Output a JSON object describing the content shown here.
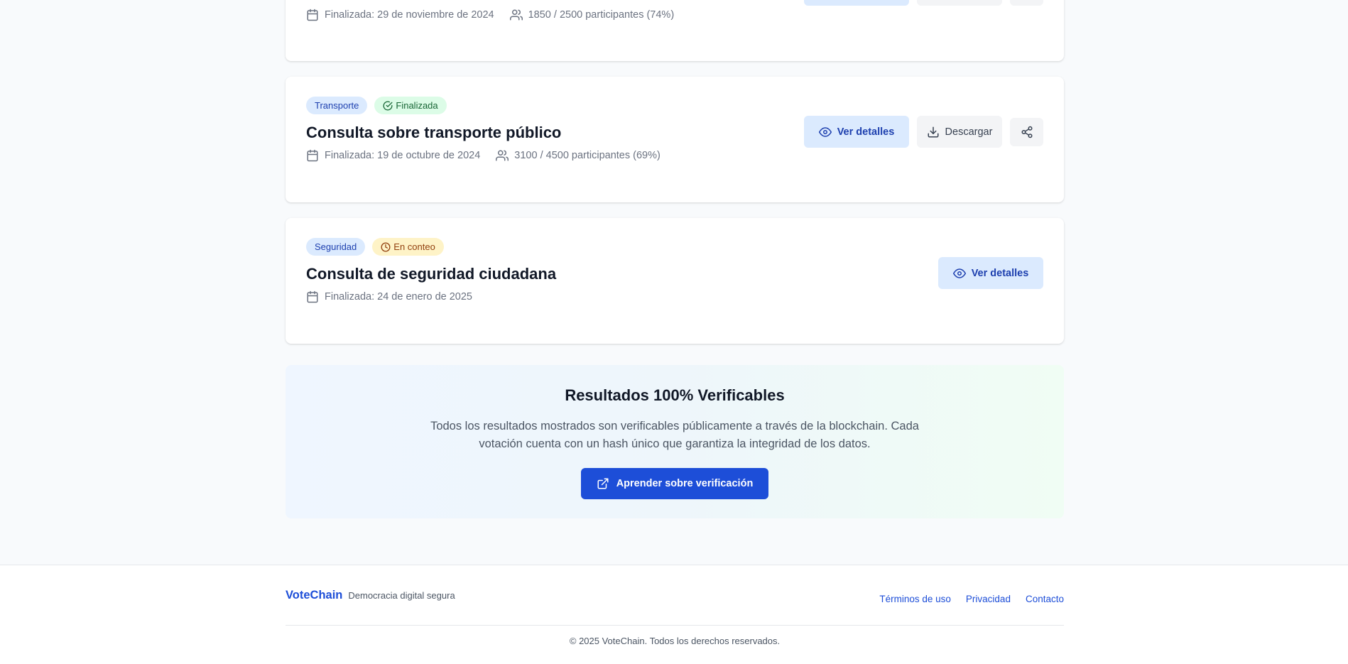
{
  "cards": [
    {
      "date": "Finalizada: 29 de noviembre de 2024",
      "participants": "1850 / 2500 participantes (74%)"
    },
    {
      "category": "Transporte",
      "status": "Finalizada",
      "title": "Consulta sobre transporte público",
      "date": "Finalizada: 19 de octubre de 2024",
      "participants": "3100 / 4500 participantes (69%)",
      "view_label": "Ver detalles",
      "download_label": "Descargar"
    },
    {
      "category": "Seguridad",
      "status": "En conteo",
      "title": "Consulta de seguridad ciudadana",
      "date": "Finalizada: 24 de enero de 2025",
      "view_label": "Ver detalles"
    }
  ],
  "verify": {
    "title": "Resultados 100% Verificables",
    "text": "Todos los resultados mostrados son verificables públicamente a través de la blockchain. Cada votación cuenta con un hash único que garantiza la integridad de los datos.",
    "button_label": "Aprender sobre verificación"
  },
  "footer": {
    "brand": "VoteChain",
    "tagline": "Democracia digital segura",
    "links": [
      "Términos de uso",
      "Privacidad",
      "Contacto"
    ],
    "copyright": "© 2025 VoteChain. Todos los derechos reservados."
  },
  "colors": {
    "accent": "#1d4ed8",
    "category_bg": "#dbeafe",
    "done_bg": "#dcfce7",
    "counting_bg": "#fef3c7",
    "page_bg": "#f8fafc"
  }
}
